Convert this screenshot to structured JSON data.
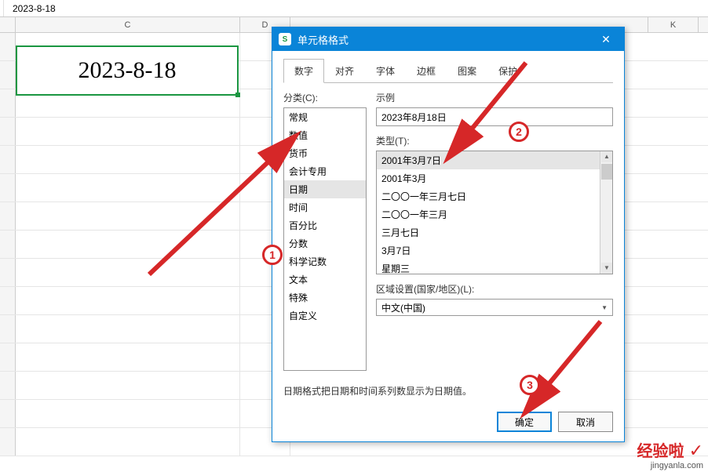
{
  "formula_bar": {
    "value": "2023-8-18"
  },
  "columns": {
    "C": "C",
    "D": "D",
    "K": "K"
  },
  "cell": {
    "value": "2023-8-18"
  },
  "dialog": {
    "title": "单元格格式",
    "tabs": [
      "数字",
      "对齐",
      "字体",
      "边框",
      "图案",
      "保护"
    ],
    "category_label": "分类(C):",
    "categories": [
      "常规",
      "数值",
      "货币",
      "会计专用",
      "日期",
      "时间",
      "百分比",
      "分数",
      "科学记数",
      "文本",
      "特殊",
      "自定义"
    ],
    "sample_label": "示例",
    "sample_value": "2023年8月18日",
    "type_label": "类型(T):",
    "types": [
      "2001年3月7日",
      "2001年3月",
      "二〇〇一年三月七日",
      "二〇〇一年三月",
      "三月七日",
      "3月7日",
      "星期三"
    ],
    "locale_label": "区域设置(国家/地区)(L):",
    "locale_value": "中文(中国)",
    "hint": "日期格式把日期和时间系列数显示为日期值。",
    "ok": "确定",
    "cancel": "取消"
  },
  "annotations": {
    "a1": "1",
    "a2": "2",
    "a3": "3"
  },
  "watermark": {
    "line1": "经验啦",
    "line2": "jingyanla.com"
  }
}
